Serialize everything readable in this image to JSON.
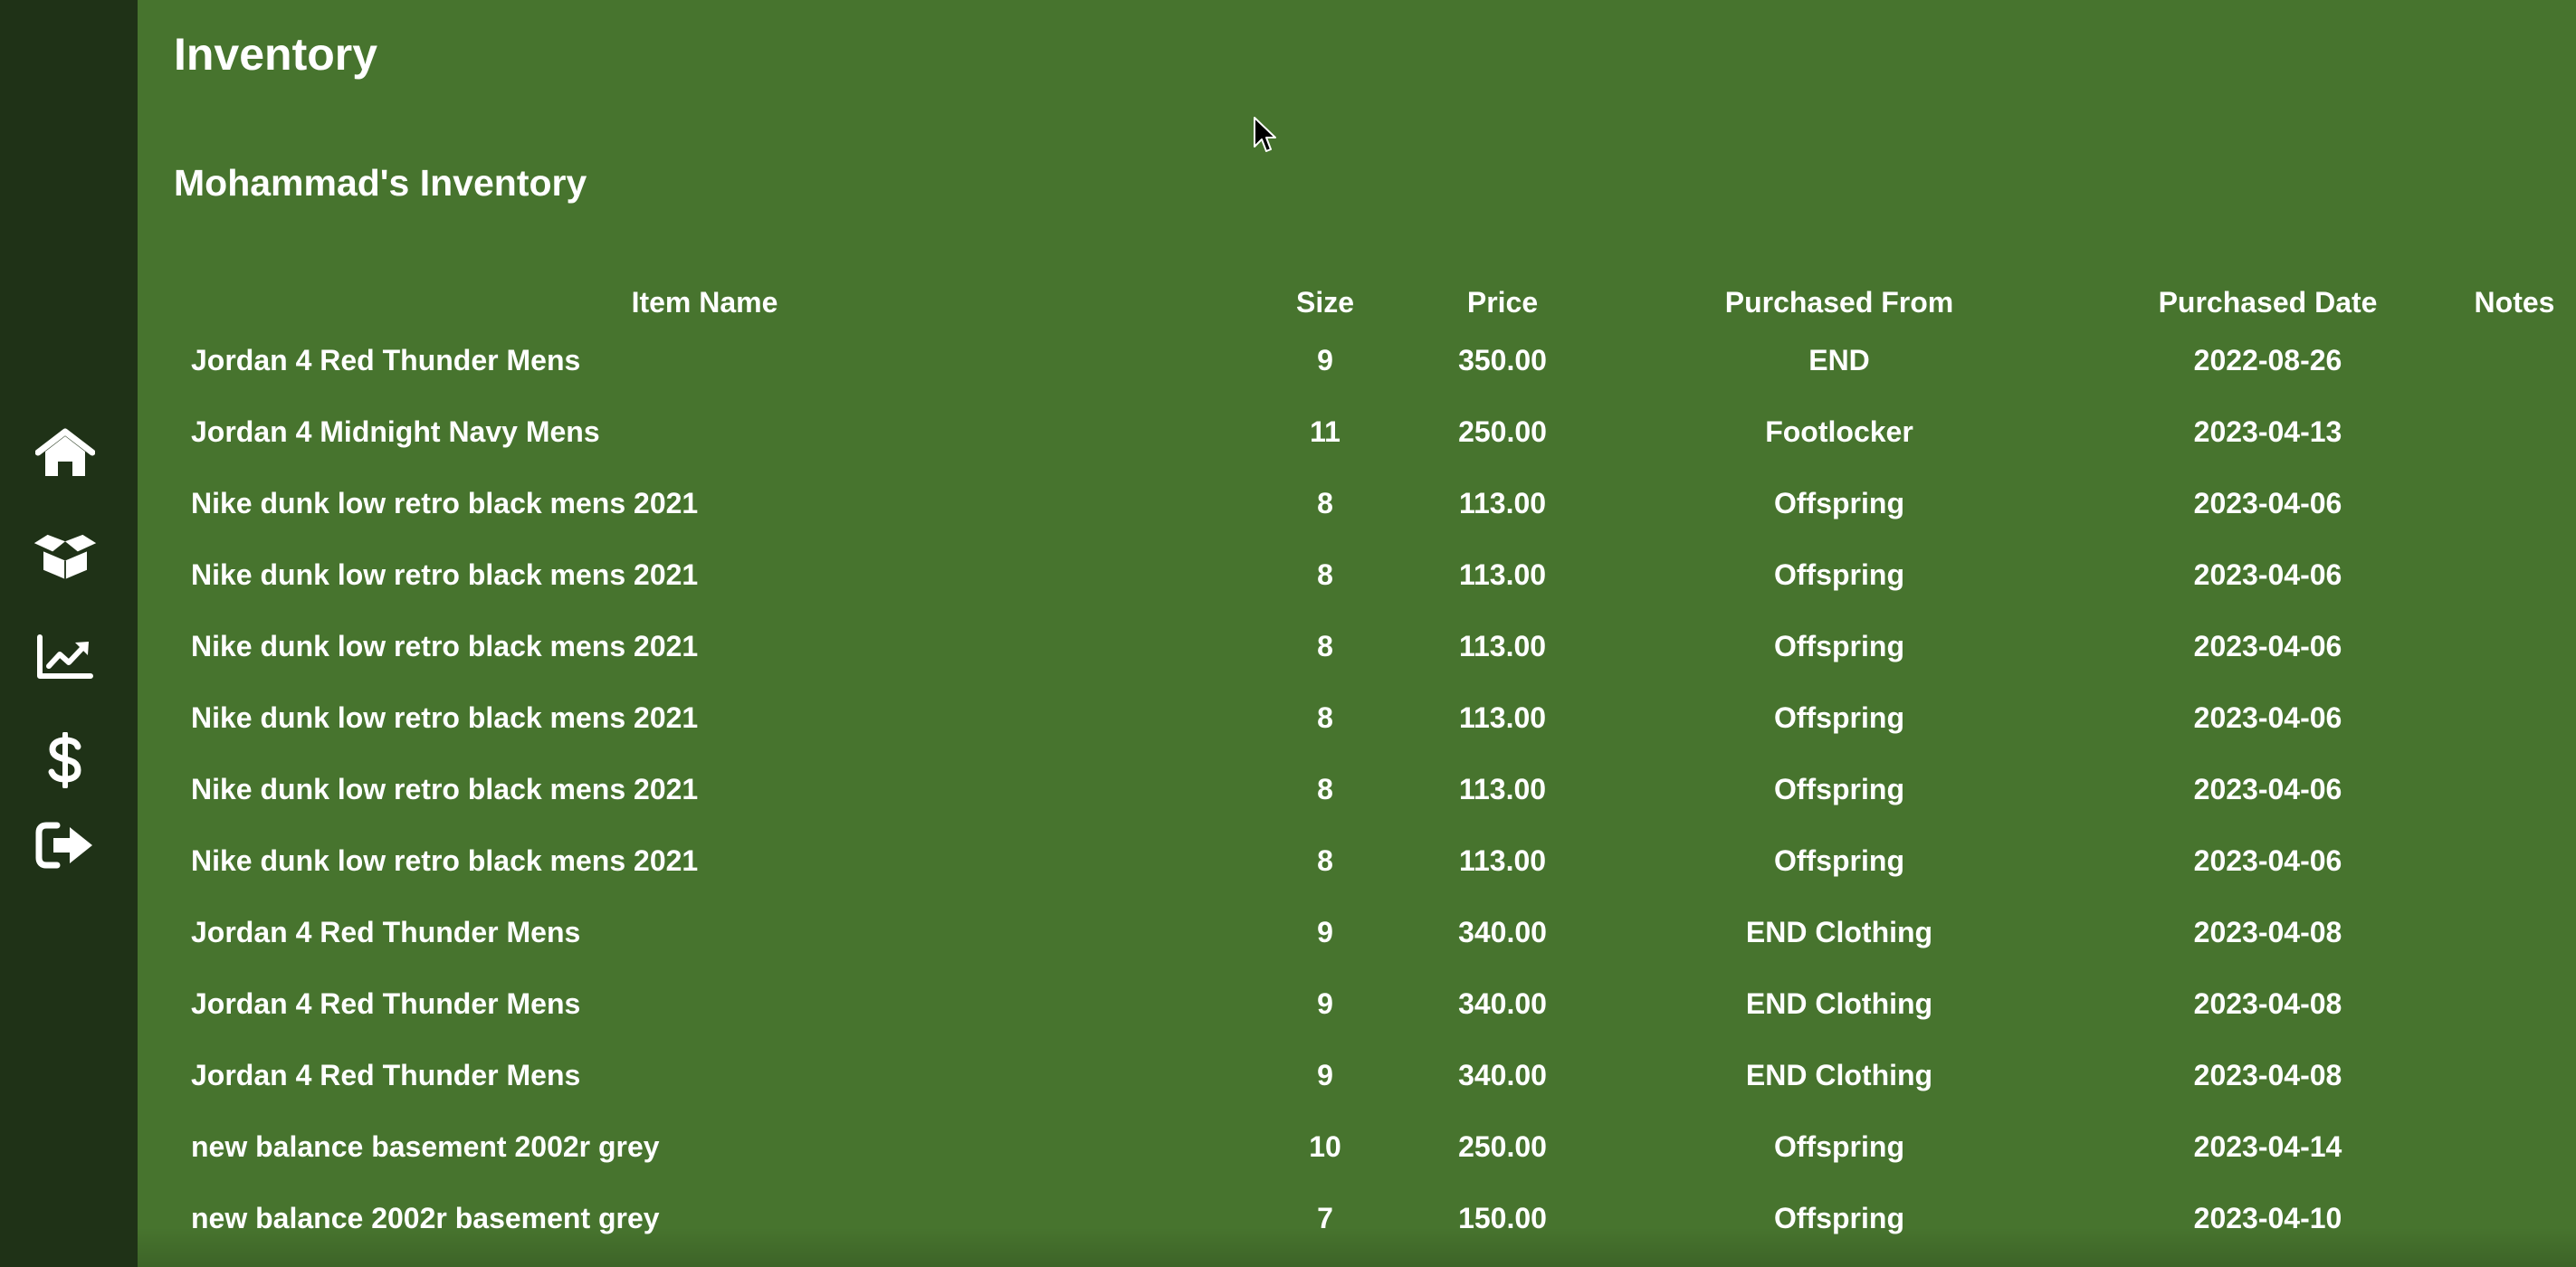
{
  "page": {
    "title": "Inventory",
    "section_title": "Mohammad's Inventory"
  },
  "sidebar": {
    "items": [
      {
        "icon": "home-icon"
      },
      {
        "icon": "open-box-icon"
      },
      {
        "icon": "chart-line-icon"
      },
      {
        "icon": "dollar-icon"
      },
      {
        "icon": "sign-out-icon"
      }
    ]
  },
  "table": {
    "headers": [
      "Item Name",
      "Size",
      "Price",
      "Purchased From",
      "Purchased Date",
      "Notes"
    ],
    "rows": [
      [
        "Jordan 4 Red Thunder Mens",
        "9",
        "350.00",
        "END",
        "2022-08-26",
        ""
      ],
      [
        "Jordan 4 Midnight Navy Mens",
        "11",
        "250.00",
        "Footlocker",
        "2023-04-13",
        ""
      ],
      [
        "Nike dunk low retro black mens 2021",
        "8",
        "113.00",
        "Offspring",
        "2023-04-06",
        ""
      ],
      [
        "Nike dunk low retro black mens 2021",
        "8",
        "113.00",
        "Offspring",
        "2023-04-06",
        ""
      ],
      [
        "Nike dunk low retro black mens 2021",
        "8",
        "113.00",
        "Offspring",
        "2023-04-06",
        ""
      ],
      [
        "Nike dunk low retro black mens 2021",
        "8",
        "113.00",
        "Offspring",
        "2023-04-06",
        ""
      ],
      [
        "Nike dunk low retro black mens 2021",
        "8",
        "113.00",
        "Offspring",
        "2023-04-06",
        ""
      ],
      [
        "Nike dunk low retro black mens 2021",
        "8",
        "113.00",
        "Offspring",
        "2023-04-06",
        ""
      ],
      [
        "Jordan 4 Red Thunder Mens",
        "9",
        "340.00",
        "END Clothing",
        "2023-04-08",
        ""
      ],
      [
        "Jordan 4 Red Thunder Mens",
        "9",
        "340.00",
        "END Clothing",
        "2023-04-08",
        ""
      ],
      [
        "Jordan 4 Red Thunder Mens",
        "9",
        "340.00",
        "END Clothing",
        "2023-04-08",
        ""
      ],
      [
        "new balance basement 2002r grey",
        "10",
        "250.00",
        "Offspring",
        "2023-04-14",
        ""
      ],
      [
        "new balance 2002r basement grey",
        "7",
        "150.00",
        "Offspring",
        "2023-04-10",
        ""
      ]
    ]
  },
  "colors": {
    "sidebar_bg": "#1f3217",
    "main_bg": "#47742e",
    "text": "#ffffff"
  }
}
